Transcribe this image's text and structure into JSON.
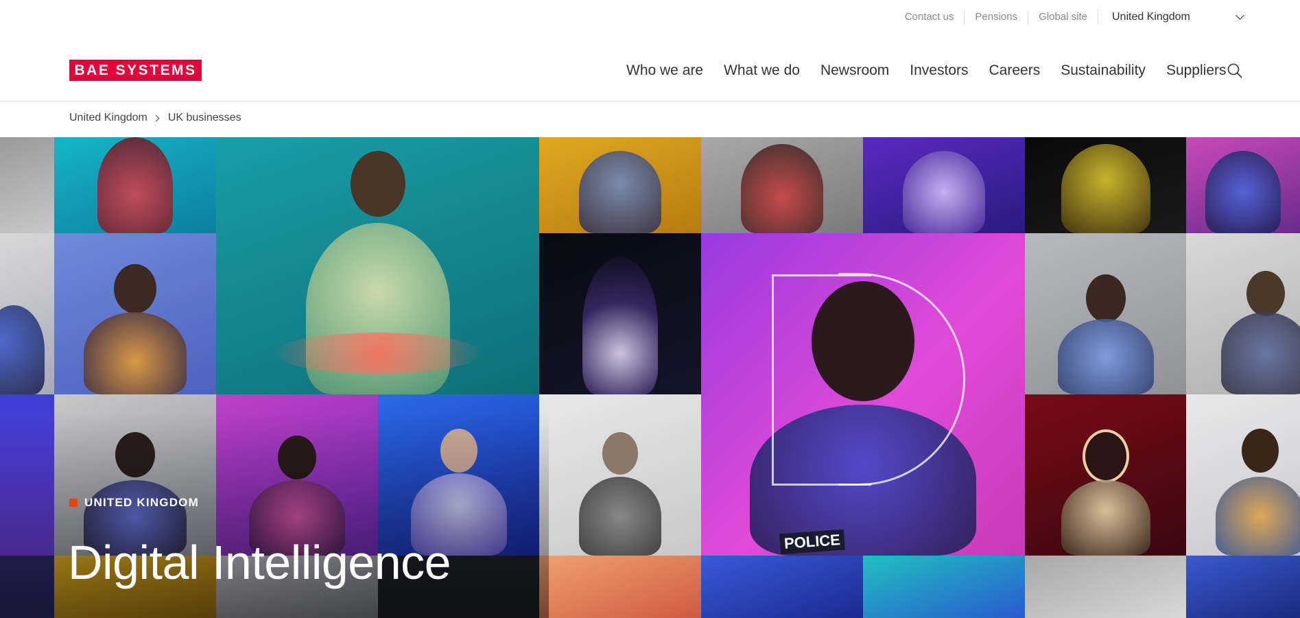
{
  "utility": {
    "links": [
      "Contact us",
      "Pensions",
      "Global site"
    ],
    "region": "United Kingdom"
  },
  "brand": {
    "logo_text": "BAE SYSTEMS",
    "color": "#e4003b"
  },
  "nav": {
    "items": [
      "Who we are",
      "What we do",
      "Newsroom",
      "Investors",
      "Careers",
      "Sustainability",
      "Suppliers"
    ],
    "search_icon": "search-icon"
  },
  "breadcrumb": [
    "United Kingdom",
    "UK businesses"
  ],
  "hero": {
    "eyebrow": "UNITED KINGDOM",
    "eyebrow_marker_color": "#e8420e",
    "title": "Digital Intelligence",
    "badge_text": "POLICE"
  }
}
